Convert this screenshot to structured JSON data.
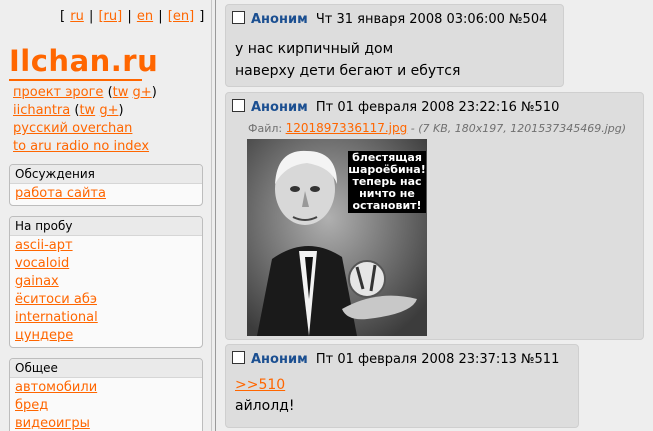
{
  "sidebar": {
    "langs": [
      "ru",
      "[ru]",
      "en",
      "[en]"
    ],
    "logo": "Ilchan.ru",
    "toplinks": [
      {
        "label": "проект эроге",
        "extra": [
          "tw",
          "g+"
        ]
      },
      {
        "label": "iichantra",
        "extra": [
          "tw",
          "g+"
        ]
      },
      {
        "label": "русский overchan",
        "extra": []
      },
      {
        "label": "to aru radio no index",
        "extra": []
      }
    ],
    "boxes": [
      {
        "title": "Обсуждения",
        "items": [
          "работа сайта"
        ]
      },
      {
        "title": "На пробу",
        "items": [
          "ascii-арт",
          "vocaloid",
          "gainax",
          "ёситоси абэ",
          "international",
          "цундере"
        ]
      },
      {
        "title": "Общее",
        "items": [
          "автомобили",
          "бред",
          "видеоигры"
        ]
      }
    ]
  },
  "posts": [
    {
      "author": "Аноним",
      "date": "Чт 31 января 2008 03:06:00",
      "num": "№504",
      "lines": [
        "у нас кирпичный дом",
        "наверху дети бегают и ебутся"
      ]
    },
    {
      "author": "Аноним",
      "date": "Пт 01 февраля 2008 23:22:16",
      "num": "№510",
      "file_label": "Файл:",
      "file_name": "1201897336117.jpg",
      "file_meta": "- (7 KB, 180x197, 1201537345469.jpg)",
      "image_caption": [
        "блестящая",
        "шароёбина!",
        "теперь нас",
        "ничто не",
        "остановит!"
      ]
    },
    {
      "author": "Аноним",
      "date": "Пт 01 февраля 2008 23:37:13",
      "num": "№511",
      "reply": ">>510",
      "lines": [
        "айлолд!"
      ]
    }
  ]
}
